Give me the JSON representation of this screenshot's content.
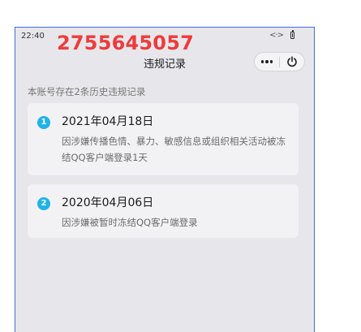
{
  "status_bar": {
    "time": "22:40",
    "vibrate_icon": "vibrate-icon",
    "battery_icon": "battery-icon"
  },
  "overlay": {
    "number": "2755645057",
    "color": "#ef3b3b"
  },
  "header": {
    "title": "违规记录",
    "more_icon": "more-dots-icon",
    "close_icon": "power-icon"
  },
  "summary": "本账号存在2条历史违规记录",
  "records": [
    {
      "index": "1",
      "date": "2021年04月18日",
      "description": "因涉嫌传播色情、暴力、敏感信息或组织相关活动被冻结QQ客户端登录1天"
    },
    {
      "index": "2",
      "date": "2020年04月06日",
      "description": "因涉嫌被暂时冻结QQ客户端登录"
    }
  ],
  "colors": {
    "frame_border": "#3f6fe0",
    "background": "#e7e7eb",
    "card": "#f2f2f5",
    "badge": "#1fb3e8"
  }
}
